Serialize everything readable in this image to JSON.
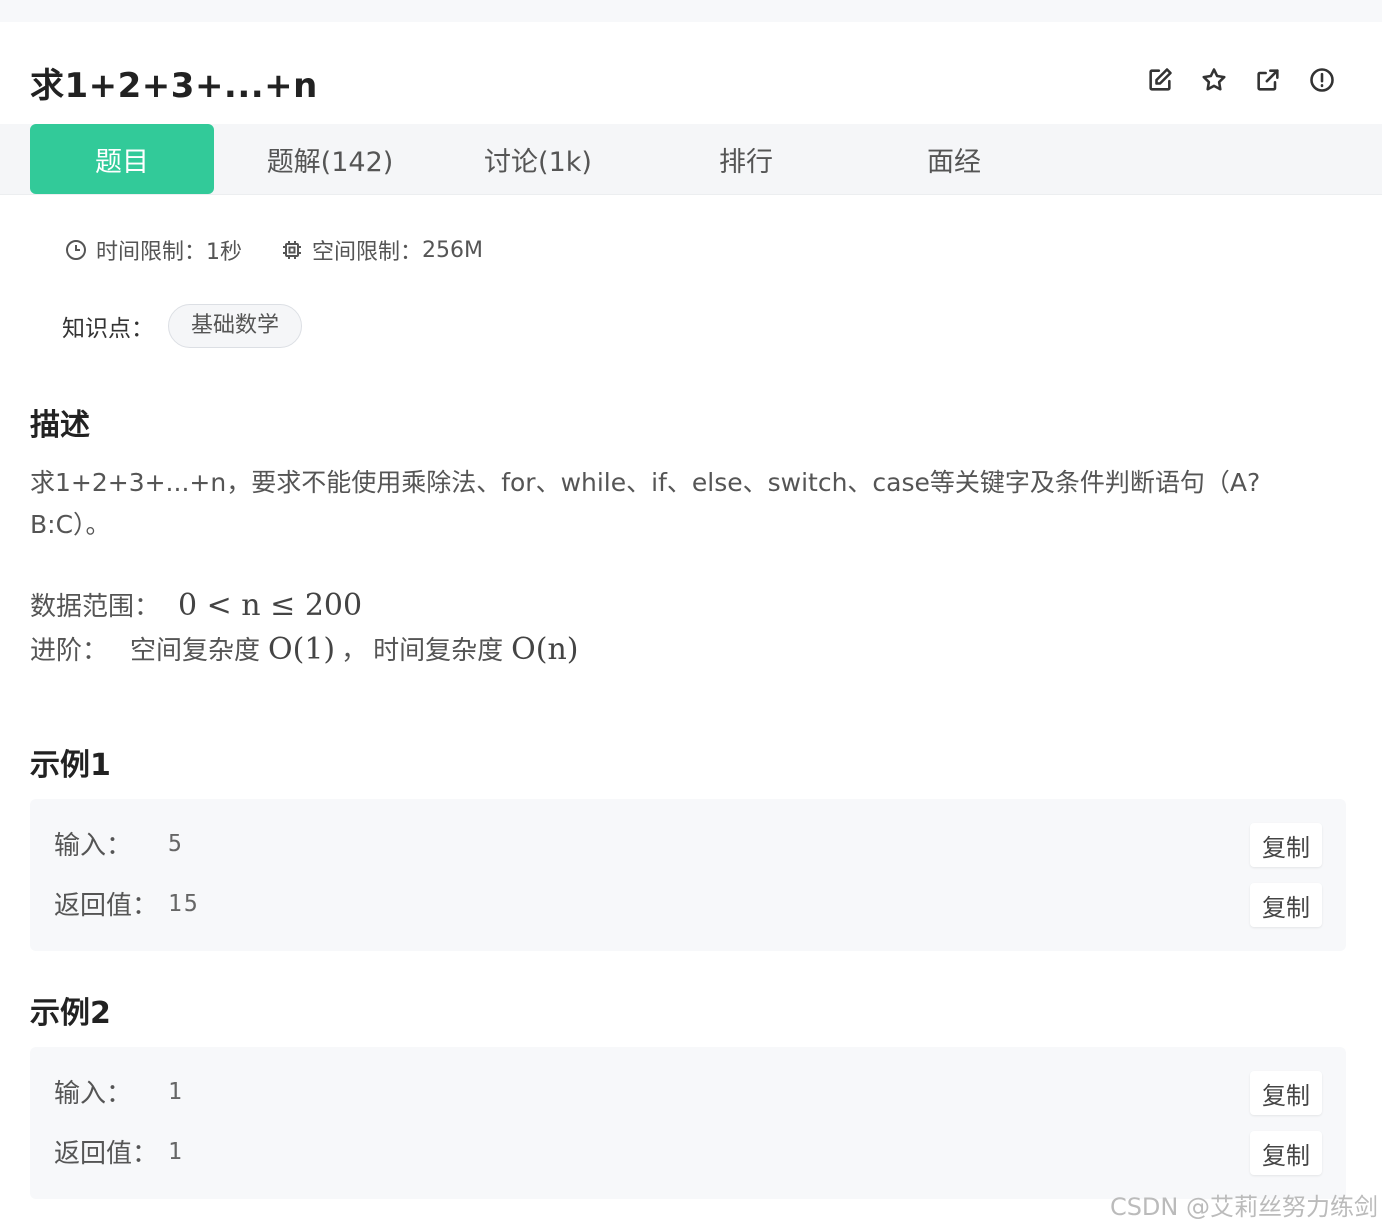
{
  "problem": {
    "title": "求1+2+3+...+n"
  },
  "actions": [
    {
      "name": "edit-icon"
    },
    {
      "name": "star-icon"
    },
    {
      "name": "share-icon"
    },
    {
      "name": "report-icon"
    }
  ],
  "tabs": [
    {
      "label": "题目",
      "active": true
    },
    {
      "label": "题解(142)"
    },
    {
      "label": "讨论(1k)"
    },
    {
      "label": "排行"
    },
    {
      "label": "面经"
    }
  ],
  "limits": {
    "time_label": "时间限制：",
    "time_value": "1秒",
    "space_label": "空间限制：",
    "space_value": "256M"
  },
  "knowledge": {
    "label": "知识点：",
    "tag": "基础数学"
  },
  "description": {
    "heading": "描述",
    "text": "求1+2+3+...+n，要求不能使用乘除法、for、while、if、else、switch、case等关键字及条件判断语句（A?B:C）。",
    "range_label": "数据范围：",
    "range_math": "0 < n ≤ 200",
    "advanced_label": "进阶：",
    "advanced_space": "空间复杂度",
    "advanced_space_math": "O(1)",
    "advanced_sep": "，",
    "advanced_time": "时间复杂度",
    "advanced_time_math": "O(n)"
  },
  "examples": [
    {
      "heading": "示例1",
      "input_label": "输入：",
      "input": "5",
      "output_label": "返回值：",
      "output": "15",
      "copy": "复制"
    },
    {
      "heading": "示例2",
      "input_label": "输入：",
      "input": "1",
      "output_label": "返回值：",
      "output": "1",
      "copy": "复制"
    }
  ],
  "watermark": "CSDN @艾莉丝努力练剑",
  "colors": {
    "accent": "#32ca99"
  }
}
